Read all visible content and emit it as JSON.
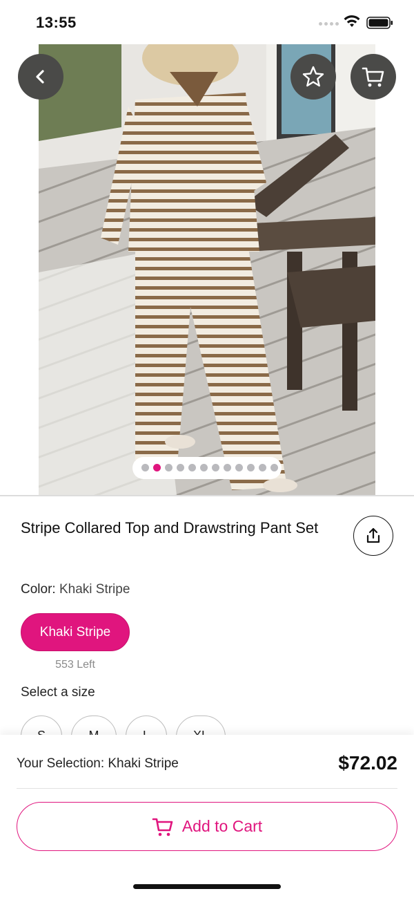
{
  "status_bar": {
    "time": "13:55",
    "icons": [
      "signal-icon",
      "wifi-icon",
      "battery-icon"
    ]
  },
  "hero": {
    "image_description": "Model in striped collared top and drawstring wide-leg pants standing on a wooden porch",
    "carousel": {
      "total": 12,
      "active_index": 1
    }
  },
  "header_buttons": {
    "back_icon": "chevron-left-icon",
    "favorite_icon": "star-icon",
    "cart_icon": "cart-icon"
  },
  "product": {
    "title": "Stripe Collared Top and Drawstring Pant Set",
    "share_icon": "share-icon",
    "color_label": "Color:",
    "color_value": "Khaki Stripe",
    "color_options": [
      "Khaki Stripe"
    ],
    "stock_text": "553 Left",
    "size_label": "Select a size",
    "sizes": [
      "S",
      "M",
      "L",
      "XL"
    ]
  },
  "footer": {
    "selection_text": "Your Selection: Khaki Stripe",
    "price": "$72.02",
    "add_to_cart_label": "Add to Cart"
  },
  "colors": {
    "accent": "#e0157e",
    "button_dark": "#4a4a48",
    "muted_text": "#8a8a8a"
  }
}
